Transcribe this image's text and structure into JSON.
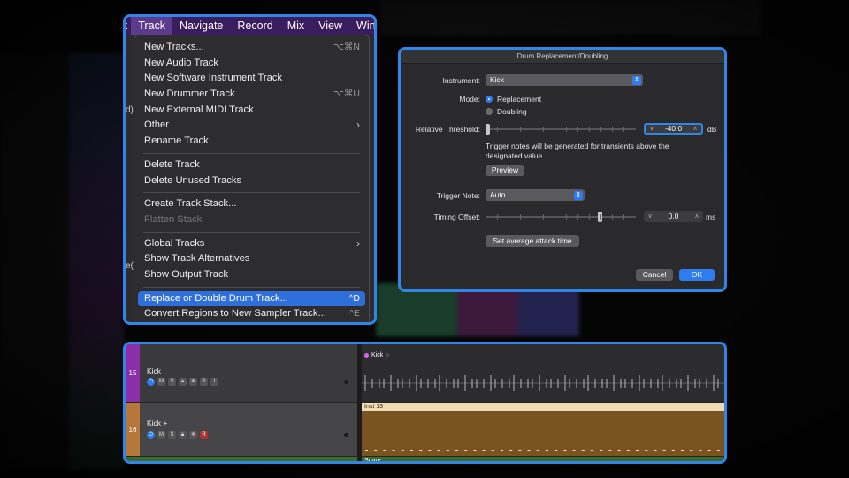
{
  "menubar": {
    "items": [
      "Track",
      "Navigate",
      "Record",
      "Mix",
      "View",
      "Window"
    ],
    "active": "Track",
    "leading_fragment": "k"
  },
  "track_menu": {
    "groups": [
      [
        {
          "label": "New Tracks...",
          "shortcut": "⌥⌘N"
        },
        {
          "label": "New Audio Track",
          "shortcut": ""
        },
        {
          "label": "New Software Instrument Track",
          "shortcut": ""
        },
        {
          "label": "New Drummer Track",
          "shortcut": "⌥⌘U"
        },
        {
          "label": "New External MIDI Track",
          "shortcut": ""
        },
        {
          "label": "Other",
          "shortcut": "",
          "submenu": true
        },
        {
          "label": "Rename Track",
          "shortcut": ""
        }
      ],
      [
        {
          "label": "Delete Track",
          "shortcut": ""
        },
        {
          "label": "Delete Unused Tracks",
          "shortcut": ""
        }
      ],
      [
        {
          "label": "Create Track Stack...",
          "shortcut": ""
        },
        {
          "label": "Flatten Stack",
          "shortcut": "",
          "disabled": true
        }
      ],
      [
        {
          "label": "Global Tracks",
          "shortcut": "",
          "submenu": true
        },
        {
          "label": "Show Track Alternatives",
          "shortcut": ""
        },
        {
          "label": "Show Output Track",
          "shortcut": ""
        }
      ],
      [
        {
          "label": "Replace or Double Drum Track...",
          "shortcut": "^D",
          "highlighted": true
        },
        {
          "label": "Convert Regions to New Sampler Track...",
          "shortcut": "^E"
        }
      ]
    ],
    "peek_left": [
      "d)",
      "e("
    ]
  },
  "dialog": {
    "title": "Drum Replacement/Doubling",
    "instrument_label": "Instrument:",
    "instrument_value": "Kick",
    "mode_label": "Mode:",
    "mode_options": [
      "Replacement",
      "Doubling"
    ],
    "mode_selected": "Replacement",
    "threshold_label": "Relative Threshold:",
    "threshold_value": "-40.0",
    "threshold_unit": "dB",
    "threshold_note": "Trigger notes will be generated for transients above the designated value.",
    "preview_label": "Preview",
    "trigger_note_label": "Trigger Note:",
    "trigger_note_value": "Auto",
    "timing_offset_label": "Timing Offset:",
    "timing_offset_value": "0.0",
    "timing_offset_unit": "ms",
    "avg_attack_label": "Set average attack time",
    "cancel_label": "Cancel",
    "ok_label": "OK",
    "colors": {
      "accent": "#2f7bf0"
    }
  },
  "tracks": [
    {
      "number": "15",
      "name": "Kick",
      "buttons": [
        "M",
        "S",
        "R",
        "I"
      ],
      "region": "Kick",
      "region_color": "#2a2a2a",
      "side_color": "#8a2fa8"
    },
    {
      "number": "16",
      "name": "Kick +",
      "buttons": [
        "M",
        "S",
        "R"
      ],
      "region": "Inst 13",
      "region_color": "#7a5420",
      "side_color": "#b5783a"
    }
  ],
  "next_region": "Snare"
}
